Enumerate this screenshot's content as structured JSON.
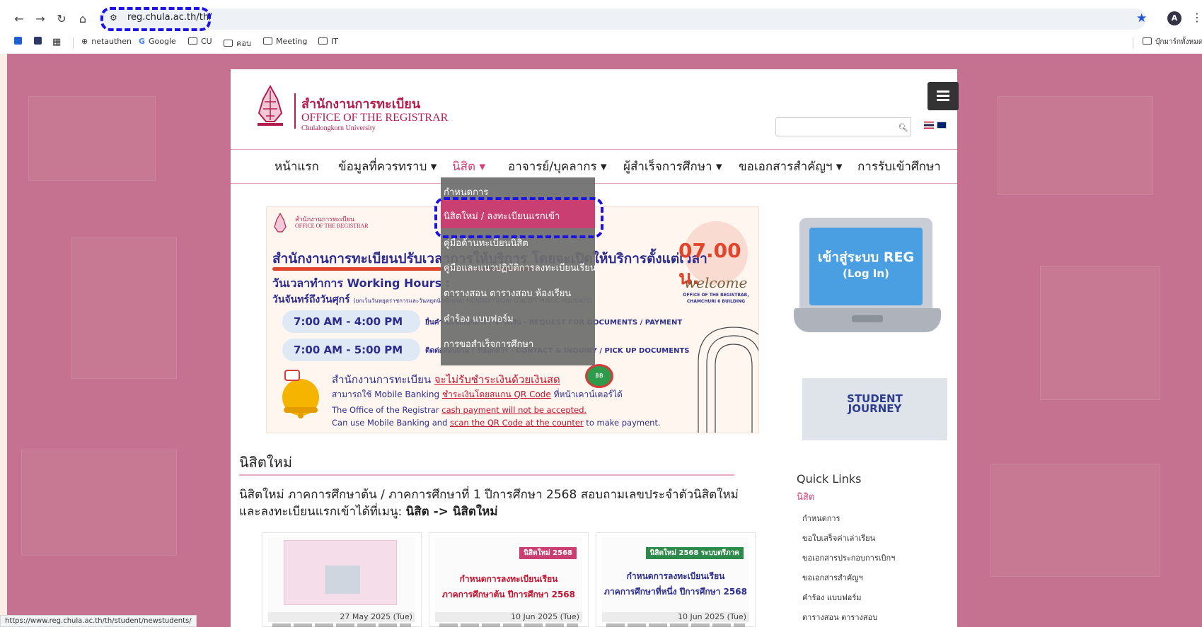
{
  "browser": {
    "url": "reg.chula.ac.th/th/",
    "profile_initial": "A",
    "bookmarks": [
      "netauthen",
      "Google",
      "CU",
      "คอบ",
      "Meeting",
      "IT"
    ],
    "bookmark_right": "บุ๊กมาร์กทั้งหมด",
    "status_url": "https://www.reg.chula.ac.th/th/student/newstudents/"
  },
  "site": {
    "logo_th": "สำนักงานการทะเบียน",
    "logo_en": "OFFICE OF THE REGISTRAR",
    "logo_sub": "Chulalongkorn University",
    "search_placeholder": "",
    "menu": [
      "หน้าแรก",
      "ข้อมูลที่ควรทราบ ▾",
      "นิสิต ▾",
      "อาจารย์/บุคลากร ▾",
      "ผู้สำเร็จการศึกษา ▾",
      "ขอเอกสารสำคัญฯ ▾",
      "การรับเข้าศึกษา"
    ],
    "dropdown": [
      "กำหนดการ",
      "นิสิตใหม่ / ลงทะเบียนแรกเข้า",
      "คู่มือด้านทะเบียนนิสิต",
      "คู่มือและแนวปฏิบัติการลงทะเบียนเรียน",
      "ตารางสอน ตารางสอบ ห้องเรียน",
      "คำร้อง แบบฟอร์ม",
      "การขอสำเร็จการศึกษา"
    ]
  },
  "banner": {
    "org_th": "สำนักงานการทะเบียน",
    "org_en": "OFFICE OF THE REGISTRAR",
    "title": "สำนักงานการทะเบียนปรับเวลาการให้บริการ โดยจะเปิดให้บริการตั้งแต่เวลา",
    "time": "07.00 น.",
    "hours_label": "วันเวลาทำการ  Working Hours :",
    "days": "วันจันทร์ถึงวันศุกร์",
    "days_note": "(ยกเว้นวันหยุดราชการและวันหยุดนักขัตฤกษ์) MONDAY-FRIDAY (EXCEPT PUBLIC HOLIDAYS)",
    "slot1": "7:00 AM - 4:00 PM",
    "slot1_note": "ยื่นคำร้องขอเอกสาร / ชำระเงิน - REQUEST FOR DOCUMENTS / PAYMENT",
    "slot2": "7:00 AM - 5:00 PM",
    "slot2_note": "ติดต่อสอบถาม / รับเอกสาร - CONTACT & INQUIRY / PICK UP DOCUMENTS",
    "welcome": "welcome",
    "office_note": "OFFICE OF THE REGISTRAR, CHAMCHURI 6 BUILDING",
    "notice1_a": "สำนักงานการทะเบียน ",
    "notice1_b": "จะไม่รับชำระเงินด้วยเงินสด",
    "notice2_a": "สามารถใช้ Mobile Banking ",
    "notice2_b": "ชำระเงินโดยสแกน QR Code",
    "notice2_c": " ที่หน้าเคาน์เตอร์ได้",
    "notice3_a": "The Office of the Registrar ",
    "notice3_b": "cash payment will not be accepted.",
    "notice4_a": "Can use Mobile Banking and ",
    "notice4_b": "scan the QR Code at the counter",
    "notice4_c": " to make payment."
  },
  "login": {
    "th": "เข้าสู่ระบบ REG",
    "en": "(Log In)"
  },
  "journey": {
    "line1": "STUDENT",
    "line2": "JOURNEY"
  },
  "news": {
    "title": "นิสิตใหม่",
    "text_a": "นิสิตใหม่ ภาคการศึกษาต้น / ภาคการศึกษาที่ 1 ปีการศึกษา 2568 สอบถามเลขประจำตัวนิสิตใหม่และลงทะเบียนแรกเข้าได้ที่เมนู: ",
    "text_b": "นิสิต -> นิสิตใหม่",
    "cards": [
      {
        "date": "27 May 2025 (Tue)",
        "tag": "",
        "h1": "",
        "h2": ""
      },
      {
        "date": "10 Jun 2025 (Tue)",
        "tag": "นิสิตใหม่ 2568",
        "h1": "กำหนดการลงทะเบียนเรียน",
        "h2": "ภาคการศึกษาต้น ปีการศึกษา 2568"
      },
      {
        "date": "10 Jun 2025 (Tue)",
        "tag": "นิสิตใหม่ 2568 ระบบตรีภาค",
        "h1": "กำหนดการลงทะเบียนเรียน",
        "h2": "ภาคการศึกษาที่หนึ่ง ปีการศึกษา 2568"
      }
    ]
  },
  "quick_links": {
    "title": "Quick Links",
    "subtitle": "นิสิต",
    "items": [
      "กำหนดการ",
      "ขอใบเสร็จค่าเล่าเรียน",
      "ขอเอกสารประกอบการเบิกฯ",
      "ขอเอกสารสำคัญฯ",
      "คำร้อง แบบฟอร์ม",
      "ตารางสอน ตารางสอบ"
    ]
  },
  "colors": {
    "brand": "#b41e4f",
    "accent": "#d3407a",
    "page_bg": "#c4728f",
    "highlight": "#1a12e6"
  }
}
